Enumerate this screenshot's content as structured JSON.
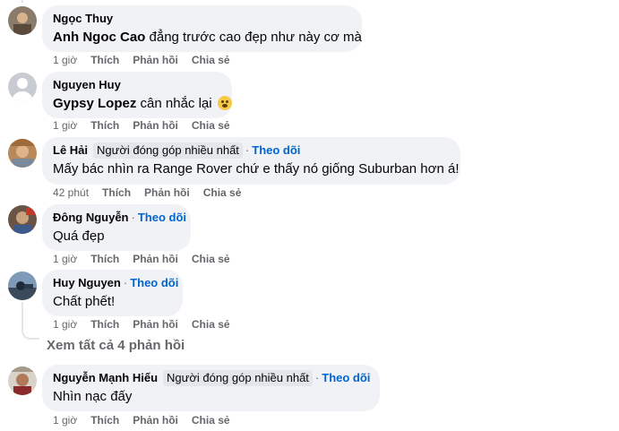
{
  "comments": [
    {
      "name": "Ngọc Thuy",
      "mention": "Anh Ngoc Cao",
      "text": " đẳng trước cao đẹp như này cơ mà",
      "time": "1 giờ",
      "actions": [
        "Thích",
        "Phản hồi",
        "Chia sẻ"
      ]
    },
    {
      "name": "Nguyen Huy",
      "mention": "Gypsy Lopez",
      "text": " cân nhắc lại ",
      "emoji": "grimace-emoji",
      "time": "1 giờ",
      "actions": [
        "Thích",
        "Phản hồi",
        "Chia sẻ"
      ]
    },
    {
      "name": "Lê Hải",
      "badge": "Người đóng góp nhiều nhất",
      "follow": "Theo dõi",
      "text": "Mấy bác nhìn ra Range Rover chứ e thấy nó giống Suburban hơn á!",
      "time": "42 phút",
      "actions": [
        "Thích",
        "Phản hồi",
        "Chia sẻ"
      ]
    },
    {
      "name": "Đông Nguyễn",
      "follow": "Theo dõi",
      "text": "Quá đẹp",
      "time": "1 giờ",
      "actions": [
        "Thích",
        "Phản hồi",
        "Chia sẻ"
      ]
    },
    {
      "name": "Huy Nguyen",
      "follow": "Theo dõi",
      "text": "Chất phết!",
      "time": "1 giờ",
      "actions": [
        "Thích",
        "Phản hồi",
        "Chia sẻ"
      ]
    },
    {
      "name": "Nguyễn Mạnh Hiếu",
      "badge": "Người đóng góp nhiều nhất",
      "follow": "Theo dõi",
      "text": "Nhìn nạc đấy",
      "time": "1 giờ",
      "actions": [
        "Thích",
        "Phản hồi",
        "Chia sẻ"
      ]
    }
  ],
  "view_replies": "Xem tất cả 4 phản hồi",
  "separator": "·",
  "colors": {
    "bubble": "#f0f2f5",
    "link": "#0064d1",
    "meta": "#65676b",
    "badge": "#e4e6eb"
  }
}
